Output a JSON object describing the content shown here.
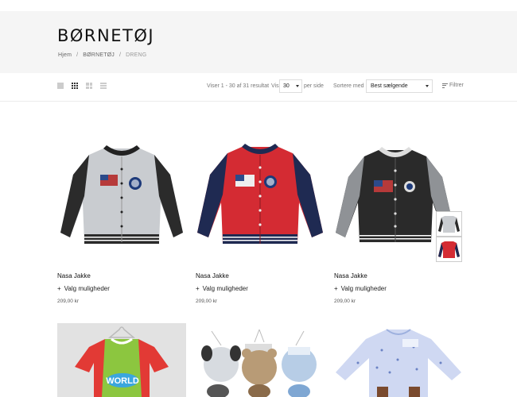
{
  "page": {
    "title": "BØRNETØJ",
    "breadcrumb": {
      "home": "Hjem",
      "sep1": "/",
      "category": "BØRNETØJ",
      "sep2": "/",
      "current": "DRENG"
    }
  },
  "toolbar": {
    "view_icons": [
      "grid-1-icon",
      "grid-3-icon",
      "grid-4-icon",
      "list-icon"
    ],
    "active_view": "grid-3-icon",
    "results_text": "Viser 1 - 30 af 31 resultat",
    "vis_label": "Vis",
    "per_page_value": "30",
    "per_page_suffix": "per side",
    "sort_label": "Sortere med",
    "sort_value": "Best sælgende",
    "filter_label": "Filtrer"
  },
  "products": [
    {
      "name": "Nasa Jakke",
      "options_icon": "+",
      "options_label": "Valg muligheder",
      "price": "209,00 kr",
      "image": "grey-bomber-jacket"
    },
    {
      "name": "Nasa Jakke",
      "options_icon": "+",
      "options_label": "Valg muligheder",
      "price": "209,00 kr",
      "image": "red-navy-bomber-jacket"
    },
    {
      "name": "Nasa Jakke",
      "options_icon": "+",
      "options_label": "Valg muligheder",
      "price": "209,00 kr",
      "image": "black-grey-bomber-jacket"
    }
  ],
  "bottom_row": [
    {
      "image": "red-green-world-tshirt",
      "text": "WORLD"
    },
    {
      "image": "animal-hats-booties-set"
    },
    {
      "image": "blue-star-romper"
    }
  ],
  "colors": {
    "header_band": "#f5f5f5",
    "text": "#222222",
    "muted": "#777777",
    "border": "#dddddd"
  }
}
